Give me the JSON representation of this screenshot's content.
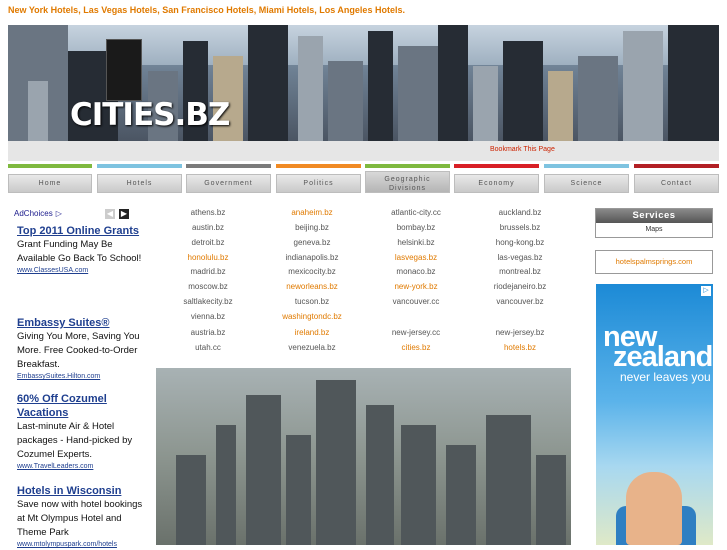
{
  "top_links": "New York Hotels, Las Vegas Hotels, San Francisco Hotels, Miami Hotels, Los Angeles Hotels.",
  "banner": {
    "logo": "CITIES.BZ"
  },
  "bookmark": "Bookmark This Page",
  "nav": [
    {
      "label": "Home",
      "color": "#7fb93f"
    },
    {
      "label": "Hotels",
      "color": "#7ec3e0"
    },
    {
      "label": "Government",
      "color": "#7b7b7b"
    },
    {
      "label": "Politics",
      "color": "#f08a24"
    },
    {
      "label": "Geographic Divisions",
      "color": "#7fb93f"
    },
    {
      "label": "Economy",
      "color": "#d81f26"
    },
    {
      "label": "Science",
      "color": "#7ec3e0"
    },
    {
      "label": "Contact",
      "color": "#b21f24"
    }
  ],
  "ads": {
    "adchoices": "AdChoices",
    "items": [
      {
        "headline": "Top 2011 Online Grants",
        "body": "Grant Funding May Be Available Go Back To School!",
        "url": "www.ClassesUSA.com"
      },
      {
        "headline": "Embassy Suites®",
        "body": "Giving You More, Saving You More. Free Cooked-to-Order Breakfast.",
        "url": "EmbassySuites.Hilton.com"
      },
      {
        "headline": "60% Off Cozumel Vacations",
        "body": "Last-minute Air & Hotel packages - Hand-picked by Cozumel Experts.",
        "url": "www.TravelLeaders.com"
      },
      {
        "headline": "Hotels in Wisconsin",
        "body": "Save now with hotel bookings at Mt Olympus Hotel and Theme Park",
        "url": "www.mtolympuspark.com/hotels"
      }
    ]
  },
  "city_rows": [
    [
      "athens.bz",
      "anaheim.bz",
      "atlantic-city.cc",
      "auckland.bz"
    ],
    [
      "austin.bz",
      "beijing.bz",
      "bombay.bz",
      "brussels.bz"
    ],
    [
      "detroit.bz",
      "geneva.bz",
      "helsinki.bz",
      "hong-kong.bz"
    ],
    [
      "honolulu.bz",
      "indianapolis.bz",
      "lasvegas.bz",
      "las-vegas.bz"
    ],
    [
      "madrid.bz",
      "mexicocity.bz",
      "monaco.bz",
      "montreal.bz"
    ],
    [
      "moscow.bz",
      "neworleans.bz",
      "new-york.bz",
      "riodejaneiro.bz"
    ],
    [
      "saltlakecity.bz",
      "tucson.bz",
      "vancouver.cc",
      "vancouver.bz"
    ],
    [
      "vienna.bz",
      "washingtondc.bz",
      "",
      ""
    ],
    [
      "austria.bz",
      "ireland.bz",
      "new-jersey.cc",
      "new-jersey.bz"
    ],
    [
      "utah.cc",
      "venezuela.bz",
      "cities.bz",
      "hotels.bz"
    ]
  ],
  "city_highlight": [
    [
      false,
      true,
      false,
      false
    ],
    [
      false,
      false,
      false,
      false
    ],
    [
      false,
      false,
      false,
      false
    ],
    [
      true,
      false,
      true,
      false
    ],
    [
      false,
      false,
      false,
      false
    ],
    [
      false,
      true,
      true,
      false
    ],
    [
      false,
      false,
      false,
      false
    ],
    [
      false,
      true,
      false,
      false
    ],
    [
      false,
      true,
      false,
      false
    ],
    [
      false,
      false,
      true,
      true
    ]
  ],
  "services": {
    "title": "Services",
    "items": [
      "Maps"
    ]
  },
  "hotel_link": "hotelspalmsprings.com",
  "nz_ad": {
    "line1": "new",
    "line2": "zealand",
    "line3": "never leaves you"
  }
}
